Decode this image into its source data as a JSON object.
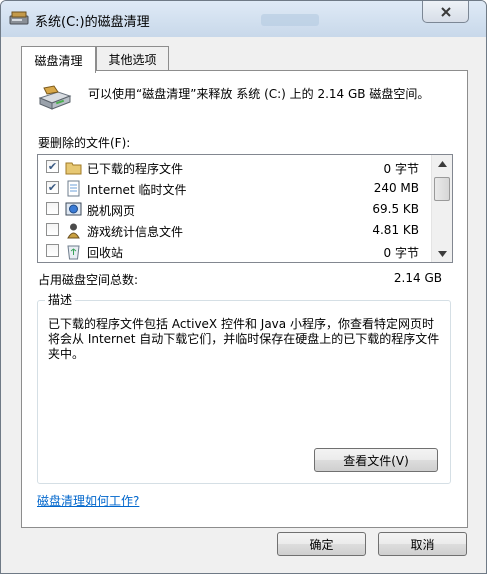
{
  "window": {
    "title": "系统(C:)的磁盘清理"
  },
  "tabs": [
    {
      "label": "磁盘清理"
    },
    {
      "label": "其他选项"
    }
  ],
  "intro_text": "可以使用“磁盘清理”来释放 系统 (C:) 上的 2.14 GB 磁盘空间。",
  "files_label": "要删除的文件(F):",
  "file_list": [
    {
      "name": "已下载的程序文件",
      "size": "0 字节",
      "checked": true,
      "icon": "folder-icon"
    },
    {
      "name": "Internet 临时文件",
      "size": "240 MB",
      "checked": true,
      "icon": "document-icon"
    },
    {
      "name": "脱机网页",
      "size": "69.5 KB",
      "checked": false,
      "icon": "offline-page-icon"
    },
    {
      "name": "游戏统计信息文件",
      "size": "4.81 KB",
      "checked": false,
      "icon": "game-icon"
    },
    {
      "name": "回收站",
      "size": "0 字节",
      "checked": false,
      "icon": "recycle-bin-icon"
    }
  ],
  "total": {
    "label": "占用磁盘空间总数:",
    "value": "2.14 GB"
  },
  "description": {
    "title": "描述",
    "text": "已下载的程序文件包括 ActiveX 控件和 Java 小程序，你查看特定网页时将会从 Internet 自动下载它们，并临时保存在硬盘上的已下载的程序文件夹中。"
  },
  "view_files_button": "查看文件(V)",
  "help_link": "磁盘清理如何工作?",
  "ok_button": "确定",
  "cancel_button": "取消",
  "colors": {
    "link": "#0066cc",
    "titlebar": "#c8d8ea",
    "dialog": "#f0f0f0"
  }
}
